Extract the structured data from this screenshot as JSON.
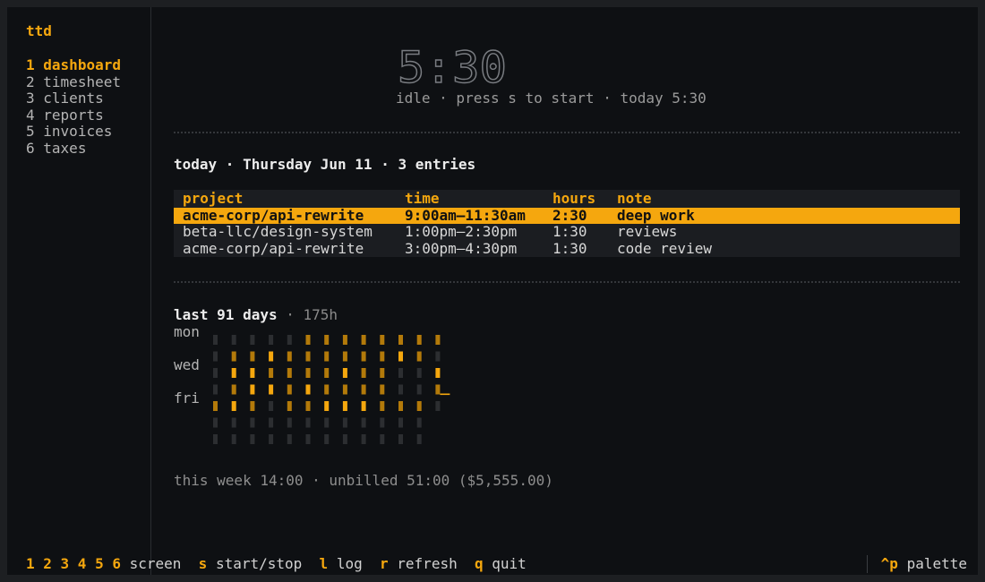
{
  "app": {
    "title": "ttd"
  },
  "nav": [
    {
      "key": "1",
      "label": "dashboard",
      "active": true
    },
    {
      "key": "2",
      "label": "timesheet",
      "active": false
    },
    {
      "key": "3",
      "label": "clients",
      "active": false
    },
    {
      "key": "4",
      "label": "reports",
      "active": false
    },
    {
      "key": "5",
      "label": "invoices",
      "active": false
    },
    {
      "key": "6",
      "label": "taxes",
      "active": false
    }
  ],
  "timer": {
    "clock": "5:30",
    "status": "idle · press s to start · today 5:30"
  },
  "today": {
    "title": "today · Thursday Jun 11 · 3 entries",
    "columns": {
      "project": "project",
      "time": "time",
      "hours": "hours",
      "note": "note"
    },
    "rows": [
      {
        "project": "acme-corp/api-rewrite",
        "time": "9:00am–11:30am",
        "hours": "2:30",
        "note": "deep work",
        "selected": true
      },
      {
        "project": "beta-llc/design-system",
        "time": "1:00pm–2:30pm",
        "hours": "1:30",
        "note": "reviews",
        "selected": false
      },
      {
        "project": "acme-corp/api-rewrite",
        "time": "3:00pm–4:30pm",
        "hours": "1:30",
        "note": "code review",
        "selected": false
      }
    ]
  },
  "heatmap": {
    "title": "last 91 days",
    "total": "175h",
    "day_labels": {
      "mon": "mon",
      "wed": "wed",
      "fri": "fri"
    },
    "levels": [
      [
        0,
        0,
        0,
        0,
        0,
        2,
        2,
        2,
        2,
        2,
        2,
        2,
        2
      ],
      [
        0,
        2,
        2,
        3,
        2,
        2,
        2,
        2,
        2,
        2,
        3,
        2,
        0
      ],
      [
        0,
        3,
        3,
        2,
        2,
        2,
        2,
        3,
        2,
        2,
        0,
        0,
        3
      ],
      [
        0,
        2,
        3,
        3,
        2,
        3,
        2,
        2,
        2,
        2,
        0,
        0,
        2
      ],
      [
        2,
        3,
        2,
        0,
        2,
        2,
        3,
        3,
        3,
        2,
        2,
        2,
        0
      ],
      [
        0,
        0,
        0,
        0,
        0,
        0,
        0,
        0,
        0,
        0,
        0,
        0,
        -1
      ],
      [
        0,
        0,
        0,
        0,
        0,
        0,
        0,
        0,
        0,
        0,
        0,
        0,
        -1
      ]
    ],
    "colors": {
      "empty": "#2c2e31",
      "low": "#6b4a0c",
      "mid": "#b37a0a",
      "high": "#f5a70e",
      "today": "#f5a70e"
    }
  },
  "totals": "this week 14:00 · unbilled 51:00 ($5,555.00)",
  "footer": {
    "items": [
      {
        "key": "1 2 3 4 5 6",
        "label": "screen"
      },
      {
        "key": "s",
        "label": "start/stop"
      },
      {
        "key": "l",
        "label": "log"
      },
      {
        "key": "r",
        "label": "refresh"
      },
      {
        "key": "q",
        "label": "quit"
      }
    ],
    "palette": {
      "key": "^p",
      "label": "palette"
    }
  }
}
